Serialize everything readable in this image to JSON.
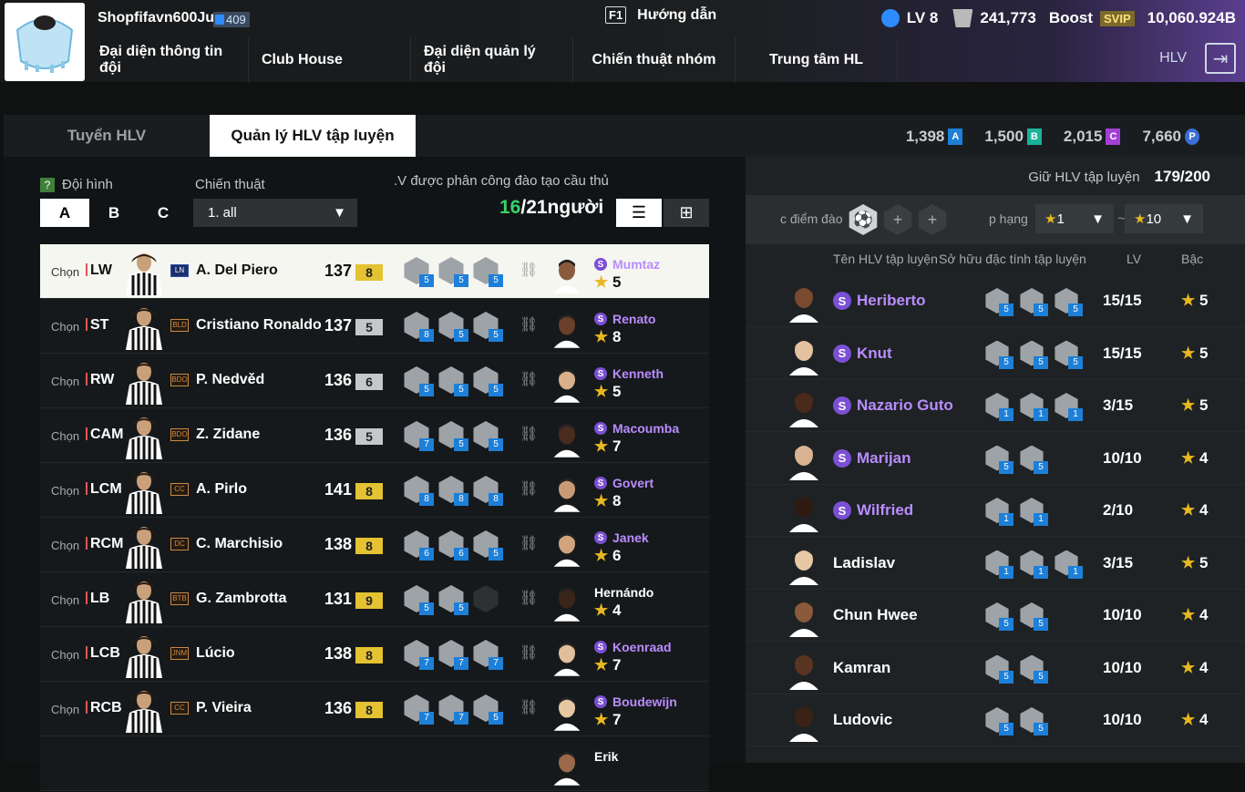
{
  "header": {
    "username": "Shopfifavn600Ju",
    "user_badge": "409",
    "guide_key": "F1",
    "guide_label": "Hướng dẫn",
    "level": "LV 8",
    "coins": "241,773",
    "boost_label": "Boost",
    "svip": "SVIP",
    "bp": "10,060.924B",
    "hlv_label": "HLV"
  },
  "nav": [
    "Đại diện thông tin đội",
    "Club House",
    "Đại diện quản lý đội",
    "Chiến thuật nhóm",
    "Trung tâm HL"
  ],
  "tabs": {
    "recruit": "Tuyển HLV",
    "manage": "Quản lý HLV tập luyện"
  },
  "currencies": [
    {
      "value": "1,398",
      "letter": "A",
      "color": "#1d7fd8"
    },
    {
      "value": "1,500",
      "letter": "B",
      "color": "#1bb39a"
    },
    {
      "value": "2,015",
      "letter": "C",
      "color": "#a33fd6"
    },
    {
      "value": "7,660",
      "letter": "P",
      "color": "#3b6fd6"
    }
  ],
  "filters": {
    "formation_label": "Đội hình",
    "tactic_label": "Chiến thuật",
    "squads": [
      "A",
      "B",
      "C"
    ],
    "tactic_value": "1. all",
    "assigned_label": ".V được phân công đào tạo cầu thủ",
    "assigned_count": "16",
    "assigned_total": "/21người"
  },
  "players": [
    {
      "chon": "Chọn",
      "pos": "LW",
      "badge": "LN",
      "name": "A. Del Piero",
      "ovr": "137",
      "grade": "8",
      "traits": [
        "5",
        "5",
        "5"
      ],
      "coach": "Mumtaz",
      "coach_star": "5",
      "s": true
    },
    {
      "chon": "Chọn",
      "pos": "ST",
      "badge": "BLD",
      "name": "Cristiano Ronaldo",
      "ovr": "137",
      "grade": "5",
      "traits": [
        "8",
        "5",
        "5"
      ],
      "coach": "Renato",
      "coach_star": "8",
      "s": true
    },
    {
      "chon": "Chọn",
      "pos": "RW",
      "badge": "BDO",
      "name": "P. Nedvěd",
      "ovr": "136",
      "grade": "6",
      "traits": [
        "5",
        "5",
        "5"
      ],
      "coach": "Kenneth",
      "coach_star": "5",
      "s": true
    },
    {
      "chon": "Chọn",
      "pos": "CAM",
      "badge": "BDO",
      "name": "Z. Zidane",
      "ovr": "136",
      "grade": "5",
      "traits": [
        "7",
        "5",
        "5"
      ],
      "coach": "Macoumba",
      "coach_star": "7",
      "s": true
    },
    {
      "chon": "Chọn",
      "pos": "LCM",
      "badge": "CC",
      "name": "A. Pirlo",
      "ovr": "141",
      "grade": "8",
      "traits": [
        "8",
        "8",
        "8"
      ],
      "coach": "Govert",
      "coach_star": "8",
      "s": true
    },
    {
      "chon": "Chọn",
      "pos": "RCM",
      "badge": "DC",
      "name": "C. Marchisio",
      "ovr": "138",
      "grade": "8",
      "traits": [
        "6",
        "6",
        "5"
      ],
      "coach": "Janek",
      "coach_star": "6",
      "s": true
    },
    {
      "chon": "Chọn",
      "pos": "LB",
      "badge": "BTB",
      "name": "G. Zambrotta",
      "ovr": "131",
      "grade": "9",
      "traits": [
        "5",
        "5",
        ""
      ],
      "coach": "Hernándo",
      "coach_star": "4",
      "s": false
    },
    {
      "chon": "Chọn",
      "pos": "LCB",
      "badge": "JNM",
      "name": "Lúcio",
      "ovr": "138",
      "grade": "8",
      "traits": [
        "7",
        "7",
        "7"
      ],
      "coach": "Koenraad",
      "coach_star": "7",
      "s": true
    },
    {
      "chon": "Chọn",
      "pos": "RCB",
      "badge": "CC",
      "name": "P. Vieira",
      "ovr": "136",
      "grade": "8",
      "traits": [
        "7",
        "7",
        "5"
      ],
      "coach": "Boudewijn",
      "coach_star": "7",
      "s": true
    },
    {
      "chon": "",
      "pos": "",
      "badge": "",
      "name": "",
      "ovr": "",
      "grade": "",
      "traits": [
        "",
        "",
        ""
      ],
      "coach": "Erik",
      "coach_star": "",
      "s": false
    }
  ],
  "right": {
    "keep_label": "Giữ HLV tập luyện",
    "keep_value": "179/200",
    "filter_label": "c điểm đào",
    "rank_label": "p hạng",
    "rank_from": "1",
    "rank_to": "10",
    "tilde": "~",
    "col_name": "Tên HLV tập luyện",
    "col_traits": "Sở hữu đặc tính tập luyện",
    "col_lv": "LV",
    "col_grade": "Bậc"
  },
  "coaches": [
    {
      "name": "Heriberto",
      "s": true,
      "traits": [
        "5",
        "5",
        "5"
      ],
      "lv": "15/15",
      "grade": "5"
    },
    {
      "name": "Knut",
      "s": true,
      "traits": [
        "5",
        "5",
        "5"
      ],
      "lv": "15/15",
      "grade": "5"
    },
    {
      "name": "Nazario Guto",
      "s": true,
      "traits": [
        "1",
        "1",
        "1"
      ],
      "lv": "3/15",
      "grade": "5"
    },
    {
      "name": "Marijan",
      "s": true,
      "traits": [
        "5",
        "5"
      ],
      "lv": "10/10",
      "grade": "4"
    },
    {
      "name": "Wilfried",
      "s": true,
      "traits": [
        "1",
        "1"
      ],
      "lv": "2/10",
      "grade": "4"
    },
    {
      "name": "Ladislav",
      "s": false,
      "traits": [
        "1",
        "1",
        "1"
      ],
      "lv": "3/15",
      "grade": "5"
    },
    {
      "name": "Chun Hwee",
      "s": false,
      "traits": [
        "5",
        "5"
      ],
      "lv": "10/10",
      "grade": "4"
    },
    {
      "name": "Kamran",
      "s": false,
      "traits": [
        "5",
        "5"
      ],
      "lv": "10/10",
      "grade": "4"
    },
    {
      "name": "Ludovic",
      "s": false,
      "traits": [
        "5",
        "5"
      ],
      "lv": "10/10",
      "grade": "4"
    }
  ]
}
